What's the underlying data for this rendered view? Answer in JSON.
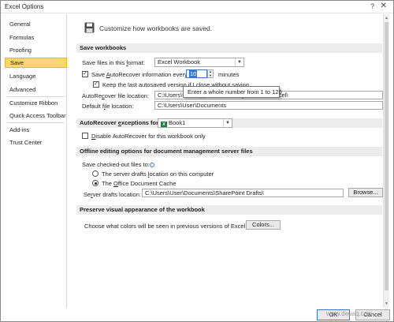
{
  "window": {
    "title": "Excel Options",
    "help_glyph": "?",
    "close_glyph": "✕"
  },
  "nav": {
    "items": [
      {
        "label": "General"
      },
      {
        "label": "Formulas"
      },
      {
        "label": "Proofing"
      },
      {
        "label": "Save",
        "selected": true
      },
      {
        "label": "Language"
      },
      {
        "label": "Advanced"
      },
      {
        "label": "Customize Ribbon"
      },
      {
        "label": "Quick Access Toolbar"
      },
      {
        "label": "Add-ins"
      },
      {
        "label": "Trust Center"
      }
    ]
  },
  "header": {
    "text": "Customize how workbooks are saved.",
    "icon": "save-icon"
  },
  "save_workbooks": {
    "title": "Save workbooks",
    "format_label_pre": "Save files in this ",
    "format_label_u": "f",
    "format_label_post": "ormat:",
    "format_value": "Excel Workbook",
    "autorecover_label_pre": "Save ",
    "autorecover_label_u": "A",
    "autorecover_label_post": "utoRecover information every",
    "autorecover_minutes": "10",
    "minutes_label": "minutes",
    "keep_last_label": "Keep the last autosaved version if I close without saving",
    "tooltip": "Enter a whole number from 1 to 120",
    "ar_location_label_pre": "AutoRe",
    "ar_location_label_u": "c",
    "ar_location_label_post": "over file location:",
    "ar_location_value": "C:\\Users\\User\\AppData\\Roaming\\Microsoft\\Excel\\",
    "default_location_label_pre": "Default f",
    "default_location_label_u": "i",
    "default_location_label_post": "le location:",
    "default_location_value": "C:\\Users\\User\\Documents"
  },
  "autorecover_exceptions": {
    "label_pre": "AutoRecover ",
    "label_u": "e",
    "label_post": "xceptions for:",
    "workbook": "Book1",
    "disable_label_pre": "",
    "disable_label_u": "D",
    "disable_label_post": "isable AutoRecover for this workbook only"
  },
  "offline": {
    "title": "Offline editing options for document management server files",
    "save_checked_out": "Save checked-out files to:",
    "server_drafts_pre": "The server drafts ",
    "server_drafts_u": "l",
    "server_drafts_post": "ocation on this computer",
    "office_cache_pre": "The ",
    "office_cache_u": "O",
    "office_cache_post": "ffice Document Cache",
    "server_location_label_pre": "Se",
    "server_location_label_u": "r",
    "server_location_label_post": "ver drafts location:",
    "server_location_value": "C:\\Users\\User\\Documents\\SharePoint Drafts\\",
    "browse_label": "Browse..."
  },
  "preserve": {
    "title": "Preserve visual appearance of the workbook",
    "colors_prompt": "Choose what colors will be seen in previous versions of Excel:",
    "colors_button": "Colors..."
  },
  "footer": {
    "ok": "OK",
    "cancel": "Cancel",
    "watermark": "www.deuaq.com"
  },
  "colors": {
    "selected_nav": "#f6d86e",
    "accent": "#3b78c3",
    "excel_green": "#1f7a3d"
  }
}
